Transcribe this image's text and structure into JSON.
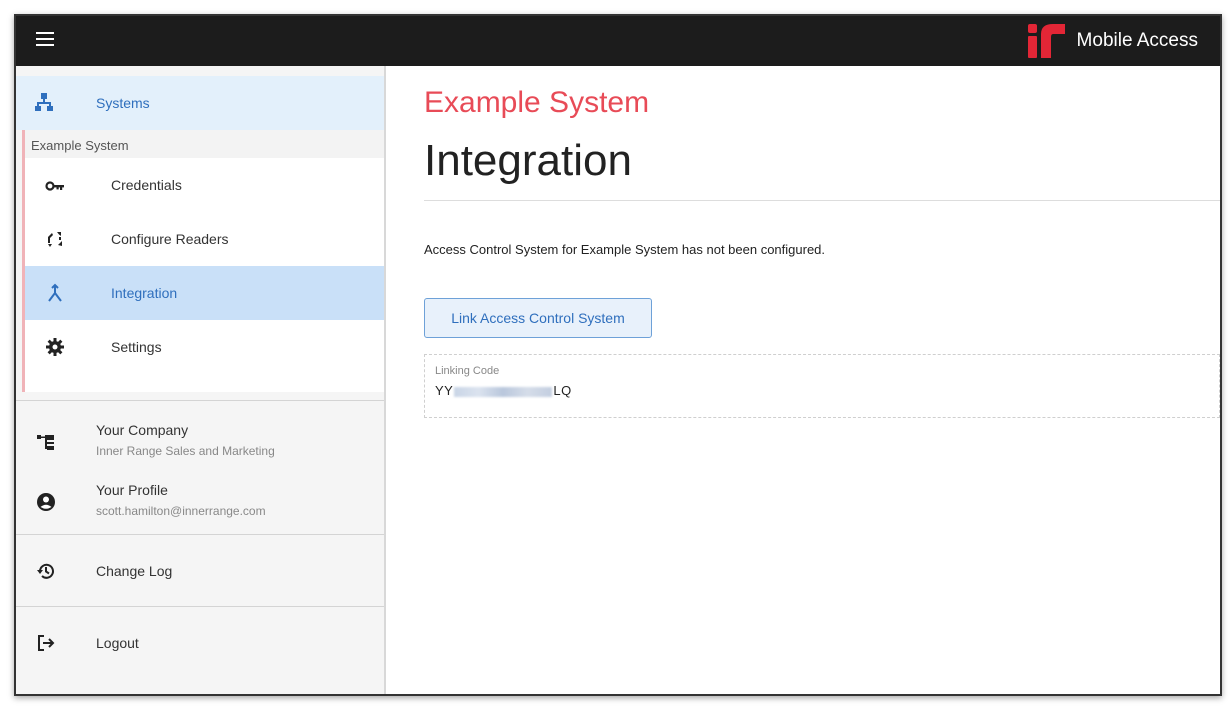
{
  "app": {
    "brand": "Mobile Access",
    "brand_color": "#e32636"
  },
  "sidebar": {
    "systems_label": "Systems",
    "system_name": "Example System",
    "nav": [
      {
        "label": "Credentials",
        "icon": "key-icon"
      },
      {
        "label": "Configure Readers",
        "icon": "configure-readers-icon"
      },
      {
        "label": "Integration",
        "icon": "integration-icon",
        "active": true
      },
      {
        "label": "Settings",
        "icon": "gear-icon"
      }
    ],
    "company": {
      "title": "Your Company",
      "subtitle": "Inner Range Sales and Marketing"
    },
    "profile": {
      "title": "Your Profile",
      "subtitle": "scott.hamilton@innerrange.com"
    },
    "change_log": "Change Log",
    "logout": "Logout"
  },
  "main": {
    "system_title": "Example System",
    "page_title": "Integration",
    "notice": "Access Control System for Example System has not been configured.",
    "link_button": "Link Access Control System",
    "linking_code_label": "Linking Code",
    "linking_code_prefix": "YY",
    "linking_code_suffix": "LQ"
  },
  "colors": {
    "accent": "#2f6fbd",
    "title_red": "#e84b57",
    "active_bg": "#c9e0f8",
    "topbar": "#1c1c1c"
  }
}
